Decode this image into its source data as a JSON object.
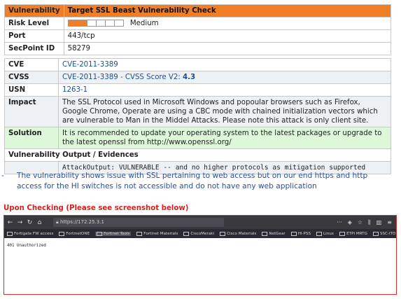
{
  "vuln": {
    "header_key": "Vulnerability",
    "header_val": "Target SSL Beast Vulnerability Check",
    "rows1": [
      {
        "key": "Risk Level",
        "val": "Medium"
      },
      {
        "key": "Port",
        "val": "443/tcp"
      },
      {
        "key": "SecPoint ID",
        "val": "58279"
      }
    ],
    "risk_fraction": 0.35,
    "cve_key": "CVE",
    "cve_val": "CVE-2011-3389",
    "cvss_key": "CVSS",
    "cvss_val": "CVE-2011-3389 - CVSS Score V2: ",
    "cvss_score": "4.3",
    "usn_key": "USN",
    "usn_val": "1263-1",
    "impact_key": "Impact",
    "impact_val": "The SSL Protocol used in Microsoft Windows and popoular browsers such as Firefox, Google Chrome, Operate are using a CBC mode with chained initialization vectors which are vulnerable to Man in the Middel Attacks. Please note this attack is only client site.",
    "solution_key": "Solution",
    "solution_val": "It is recommended to update your operating system to the latest packages or upgrade to the latest openssl from http://www.openssl.org/",
    "output_header": "Vulnerability Output / Evidences",
    "output_val": "AttackOutput: VULNERABLE -- and no higher protocols as mitigation supported"
  },
  "note": {
    "dash": "-",
    "text": "The vulnerability shows issue with SSL pertaining to web access but on our end https and http access for the HI switches is not accessible and do not have any web application"
  },
  "upon_checking": "Upon Checking (Please see screenshot below)",
  "browser": {
    "url": "https://172.25.3.1",
    "url_dots": "···",
    "bookmarks": [
      "Fortigate FW access",
      "FortinetONE",
      "Fortinet Tools",
      "Fortinet Materials",
      "CiscoMeraki",
      "Cisco Materials",
      "NetGear",
      "HI-PSS",
      "Linux",
      "ETPI MRTG",
      "SSC-ITD"
    ],
    "active_bookmark_index": 2,
    "body_text": "401 Unauthorized"
  }
}
